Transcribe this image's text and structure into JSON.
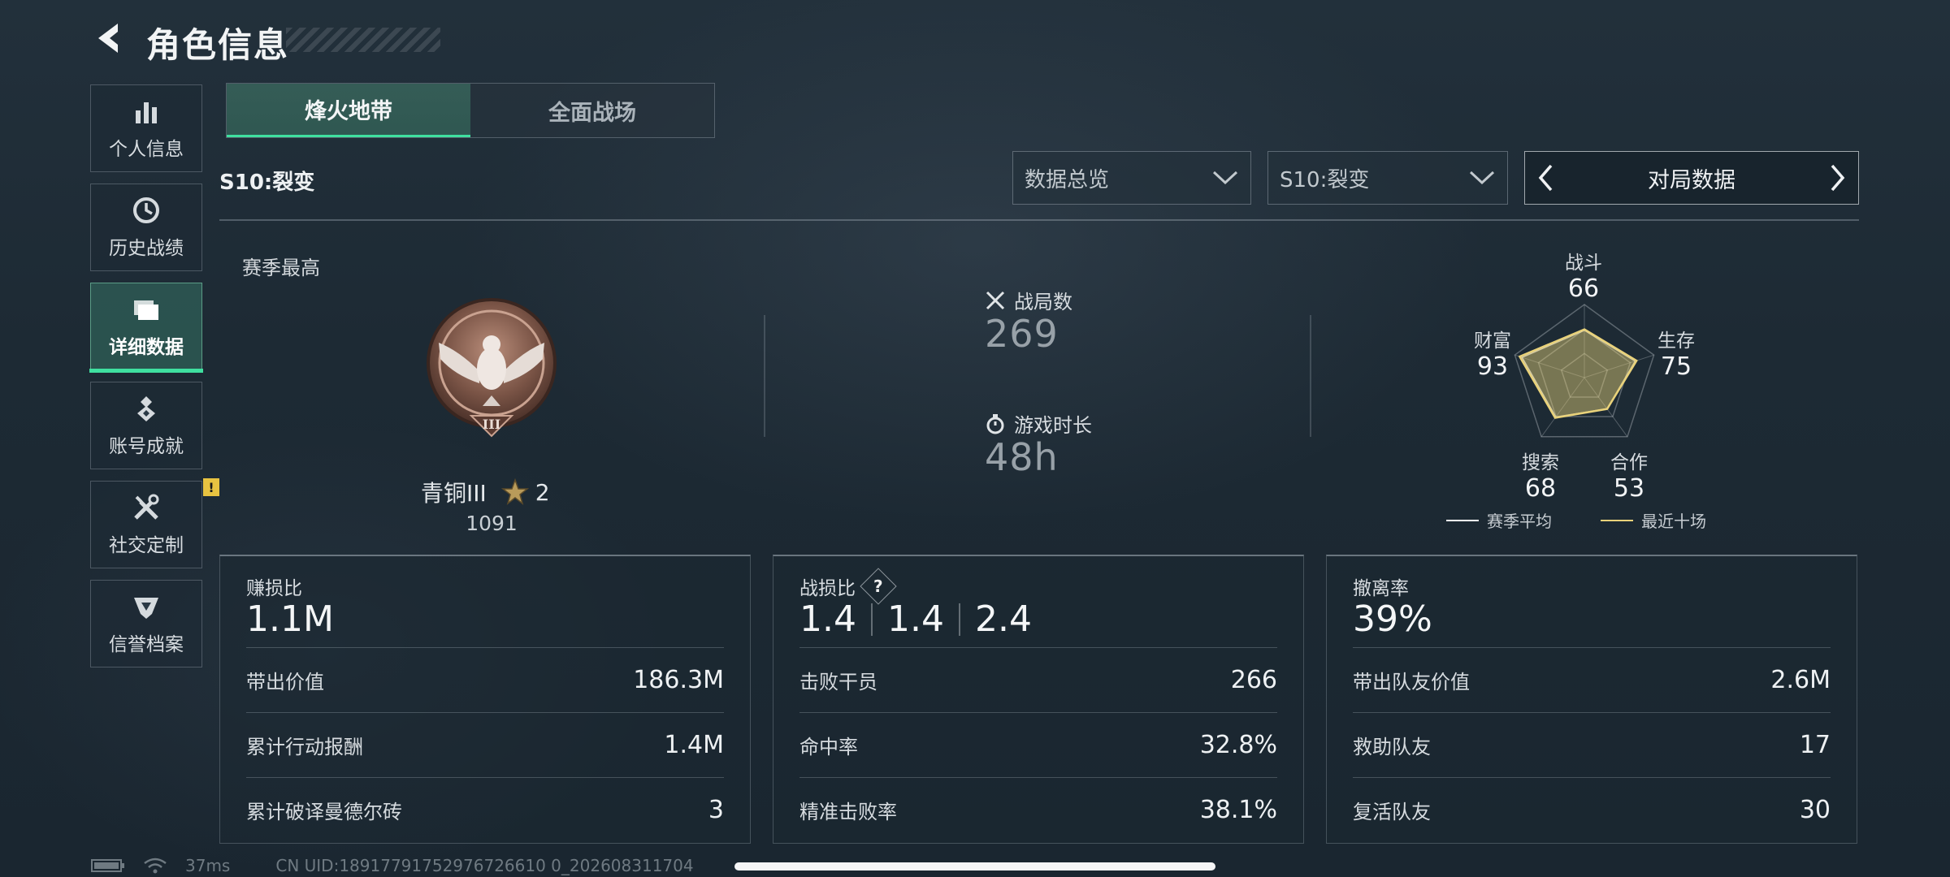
{
  "header": {
    "title": "角色信息"
  },
  "sidebar": {
    "items": [
      {
        "label": "个人信息",
        "icon": "bar-chart-icon"
      },
      {
        "label": "历史战绩",
        "icon": "clock-icon"
      },
      {
        "label": "详细数据",
        "icon": "folder-icon",
        "active": true
      },
      {
        "label": "账号成就",
        "icon": "medal-icon"
      },
      {
        "label": "社交定制",
        "icon": "tools-icon",
        "badge": "!"
      },
      {
        "label": "信誉档案",
        "icon": "shield-wing-icon"
      }
    ]
  },
  "tabs": [
    {
      "label": "烽火地带",
      "active": true
    },
    {
      "label": "全面战场",
      "active": false
    }
  ],
  "season": "S10:裂变",
  "filters": {
    "overview": "数据总览",
    "season_select": "S10:裂变",
    "pager_label": "对局数据"
  },
  "rank": {
    "heading": "赛季最高",
    "name": "青铜III",
    "stars": "2",
    "score": "1091"
  },
  "summary": {
    "matches_label": "战局数",
    "matches_value": "269",
    "playtime_label": "游戏时长",
    "playtime_value": "48h"
  },
  "radar": {
    "axes": [
      {
        "name": "战斗",
        "value": 66
      },
      {
        "name": "生存",
        "value": 75
      },
      {
        "name": "合作",
        "value": 53
      },
      {
        "name": "搜索",
        "value": 68
      },
      {
        "name": "财富",
        "value": 93
      }
    ],
    "legend": {
      "season_avg": "赛季平均",
      "recent_ten": "最近十场"
    },
    "colors": {
      "recent": "#e9d27a",
      "avg": "#ffffff"
    }
  },
  "cards": {
    "profit": {
      "heading": "赚损比",
      "value": "1.1M",
      "rows": [
        {
          "label": "带出价值",
          "value": "186.3M"
        },
        {
          "label": "累计行动报酬",
          "value": "1.4M"
        },
        {
          "label": "累计破译曼德尔砖",
          "value": "3"
        }
      ]
    },
    "kd": {
      "heading": "战损比",
      "values": [
        "1.4",
        "1.4",
        "2.4"
      ],
      "rows": [
        {
          "label": "击败干员",
          "value": "266"
        },
        {
          "label": "命中率",
          "value": "32.8%"
        },
        {
          "label": "精准击败率",
          "value": "38.1%"
        }
      ]
    },
    "extract": {
      "heading": "撤离率",
      "value": "39%",
      "rows": [
        {
          "label": "带出队友价值",
          "value": "2.6M"
        },
        {
          "label": "救助队友",
          "value": "17"
        },
        {
          "label": "复活队友",
          "value": "30"
        }
      ]
    }
  },
  "footer": {
    "latency": "37ms",
    "uid": "CN UID:18917791752976726610 0_202608311704"
  },
  "accent": "#3fe0a0"
}
